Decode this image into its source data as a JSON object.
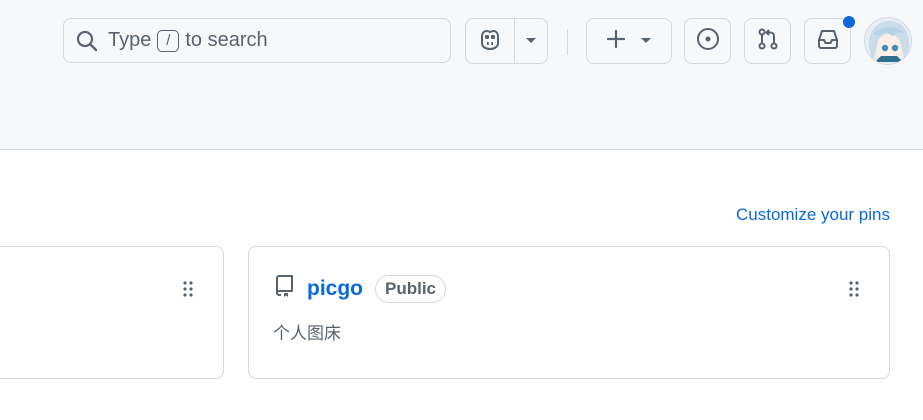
{
  "header": {
    "search": {
      "prefix": "Type",
      "key": "/",
      "suffix": "to search"
    },
    "icons": {
      "search": "search-icon",
      "copilot": "copilot-icon",
      "dropdown": "triangle-down-icon",
      "create": "plus-icon",
      "issues": "issue-opened-icon",
      "pulls": "git-pull-request-icon",
      "inbox": "inbox-icon"
    },
    "notification_color": "#0969da"
  },
  "pinned": {
    "customize_label": "Customize your pins",
    "cards": [
      {
        "name": "picgo",
        "visibility": "Public",
        "description": "个人图床"
      }
    ]
  },
  "colors": {
    "accent": "#0969da",
    "header_bg": "#f6f8fa",
    "border": "#d1d9e0",
    "muted": "#59636e"
  }
}
